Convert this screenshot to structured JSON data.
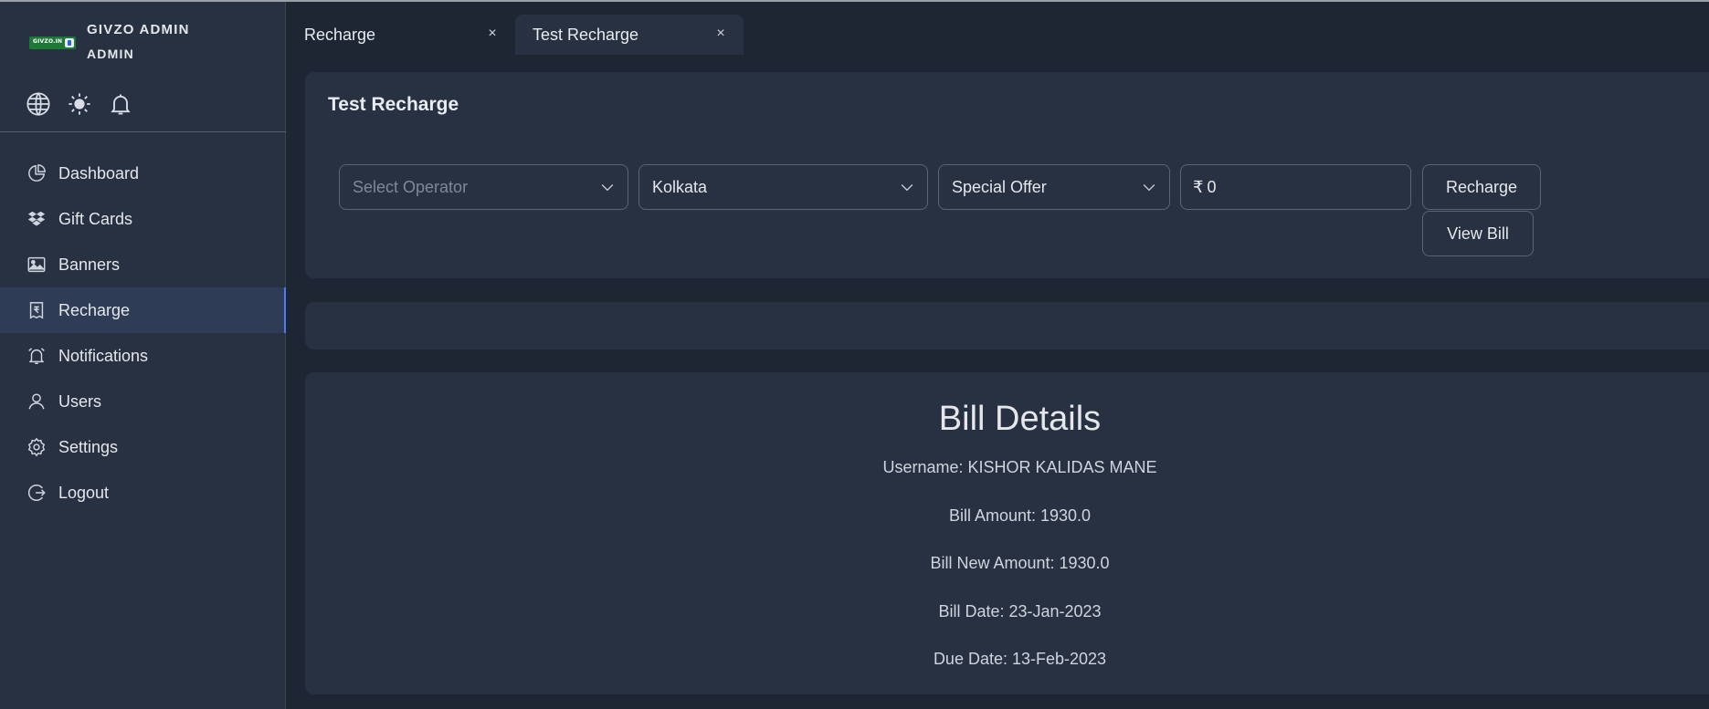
{
  "brand": {
    "title": "GIVZO ADMIN",
    "role": "ADMIN",
    "logo_text": "GIVZO.IN"
  },
  "quick_icons": [
    "globe-icon",
    "sun-icon",
    "bell-icon"
  ],
  "sidebar": {
    "items": [
      {
        "label": "Dashboard",
        "icon": "pie-chart-icon"
      },
      {
        "label": "Gift Cards",
        "icon": "dropbox-icon"
      },
      {
        "label": "Banners",
        "icon": "image-icon"
      },
      {
        "label": "Recharge",
        "icon": "rupee-receipt-icon",
        "active": true
      },
      {
        "label": "Notifications",
        "icon": "alarm-icon"
      },
      {
        "label": "Users",
        "icon": "user-icon"
      },
      {
        "label": "Settings",
        "icon": "gear-icon"
      },
      {
        "label": "Logout",
        "icon": "logout-icon"
      }
    ]
  },
  "tabs": [
    {
      "label": "Recharge",
      "close": "×"
    },
    {
      "label": "Test Recharge",
      "close": "×",
      "active": true
    }
  ],
  "form": {
    "title": "Test Recharge",
    "operator_placeholder": "Select Operator",
    "circle_value": "Kolkata",
    "plan_value": "Special Offer",
    "currency_symbol": "₹",
    "amount_value": "0",
    "recharge_button": "Recharge",
    "view_bill_button": "View Bill"
  },
  "bill": {
    "title": "Bill Details",
    "username": "Username: KISHOR KALIDAS MANE",
    "amount": "Bill Amount: 1930.0",
    "new_amount": "Bill New Amount: 1930.0",
    "bill_date": "Bill Date: 23-Jan-2023",
    "due_date": "Due Date: 13-Feb-2023"
  },
  "colors": {
    "background": "#1e2633",
    "panel": "#283142",
    "active_nav": "#2f3c55",
    "accent": "#4a7cf0",
    "logo_green": "#1d7a36"
  }
}
